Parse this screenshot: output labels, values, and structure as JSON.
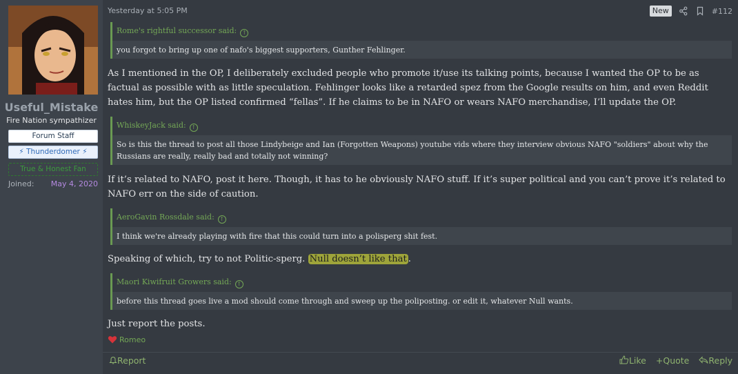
{
  "author": {
    "username": "Useful_Mistake",
    "user_title": "Fire Nation sympathizer",
    "banners": [
      "Forum Staff",
      "⚡ Thunderdomer ⚡",
      "True & Honest Fan"
    ],
    "joined_label": "Joined:",
    "joined_value": "May 4, 2020"
  },
  "post": {
    "date": "Yesterday at 5:05 PM",
    "new_badge": "New",
    "number": "#112",
    "quotes": [
      {
        "author": "Rome's rightful successor said:",
        "text": "you forgot to bring up one of nafo's biggest supporters, Gunther Fehlinger."
      },
      {
        "author": "WhiskeyJack said:",
        "text": "So is this the thread to post all those Lindybeige and Ian (Forgotten Weapons) youtube vids where they interview obvious NAFO \"soldiers\" about why the Russians are really, really bad and totally not winning?"
      },
      {
        "author": "AeroGavin Rossdale said:",
        "text": "I think we're already playing with fire that this could turn into a polisperg shit fest."
      },
      {
        "author": "Maori Kiwifruit Growers said:",
        "text": "before this thread goes live a mod should come through and sweep up the poliposting. or edit it, whatever Null wants."
      }
    ],
    "paragraphs": {
      "p1": "As I mentioned in the OP, I deliberately excluded people who promote it/use its talking points, because I wanted the OP to be as factual as possible with as little speculation. Fehlinger looks like a retarded spez from the Google results on him, and even Reddit hates him, but the OP listed confirmed “fellas”. If he claims to be in NAFO or wears NAFO merchandise, I’ll update the OP.",
      "p2": "If it’s related to NAFO, post it here. Though, it has to he obviously NAFO stuff. If it’s super political and you can’t prove it’s related to NAFO err on the side of caution.",
      "p3_before": "Speaking of which, try to not Politic-sperg. ",
      "p3_highlight": "Null doesn’t like that",
      "p3_after": ".",
      "p4": "Just report the posts."
    },
    "reaction_user": "Romeo"
  },
  "footer": {
    "report": "Report",
    "like": "Like",
    "quote": "Quote",
    "reply": "Reply"
  }
}
